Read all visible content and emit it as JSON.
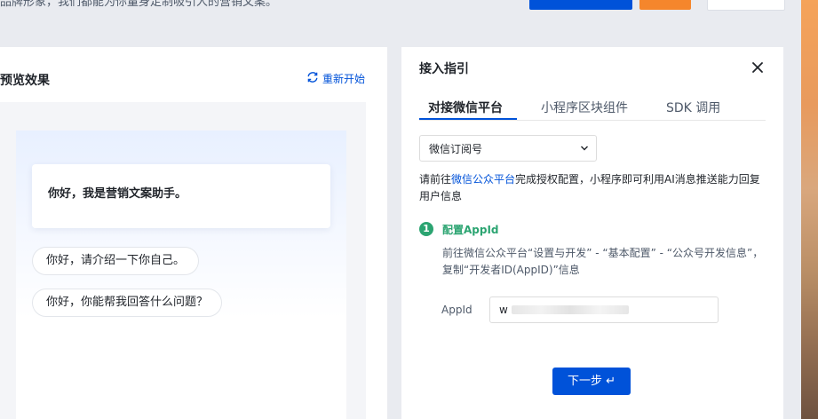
{
  "header": {
    "description": "品牌形象，我们都能为你量身定制吸引人的营销文案。"
  },
  "preview": {
    "title": "预览效果",
    "restart_label": "重新开始",
    "greeting": "你好，我是营销文案助手。",
    "suggestions": [
      "你好，请介绍一下你自己。",
      "你好，你能帮我回答什么问题？"
    ]
  },
  "guide": {
    "title": "接入指引",
    "tabs": [
      {
        "label": "对接微信平台",
        "active": true
      },
      {
        "label": "小程序区块组件",
        "active": false
      },
      {
        "label": "SDK 调用",
        "active": false
      }
    ],
    "select_value": "微信订阅号",
    "info_prefix": "请前往",
    "info_link": "微信公众平台",
    "info_suffix": "完成授权配置，小程序即可利用AI消息推送能力回复用户信息",
    "step": {
      "number": "1",
      "title": "配置AppId",
      "description": "前往微信公众平台“设置与开发” - “基本配置” - “公众号开发信息”，复制“开发者ID(AppID)”信息"
    },
    "appid_label": "AppId",
    "appid_value": "w",
    "next_label": "下一步 ↵"
  },
  "colors": {
    "accent": "#0052d9",
    "success": "#2ba471",
    "orange": "#f5862c"
  }
}
